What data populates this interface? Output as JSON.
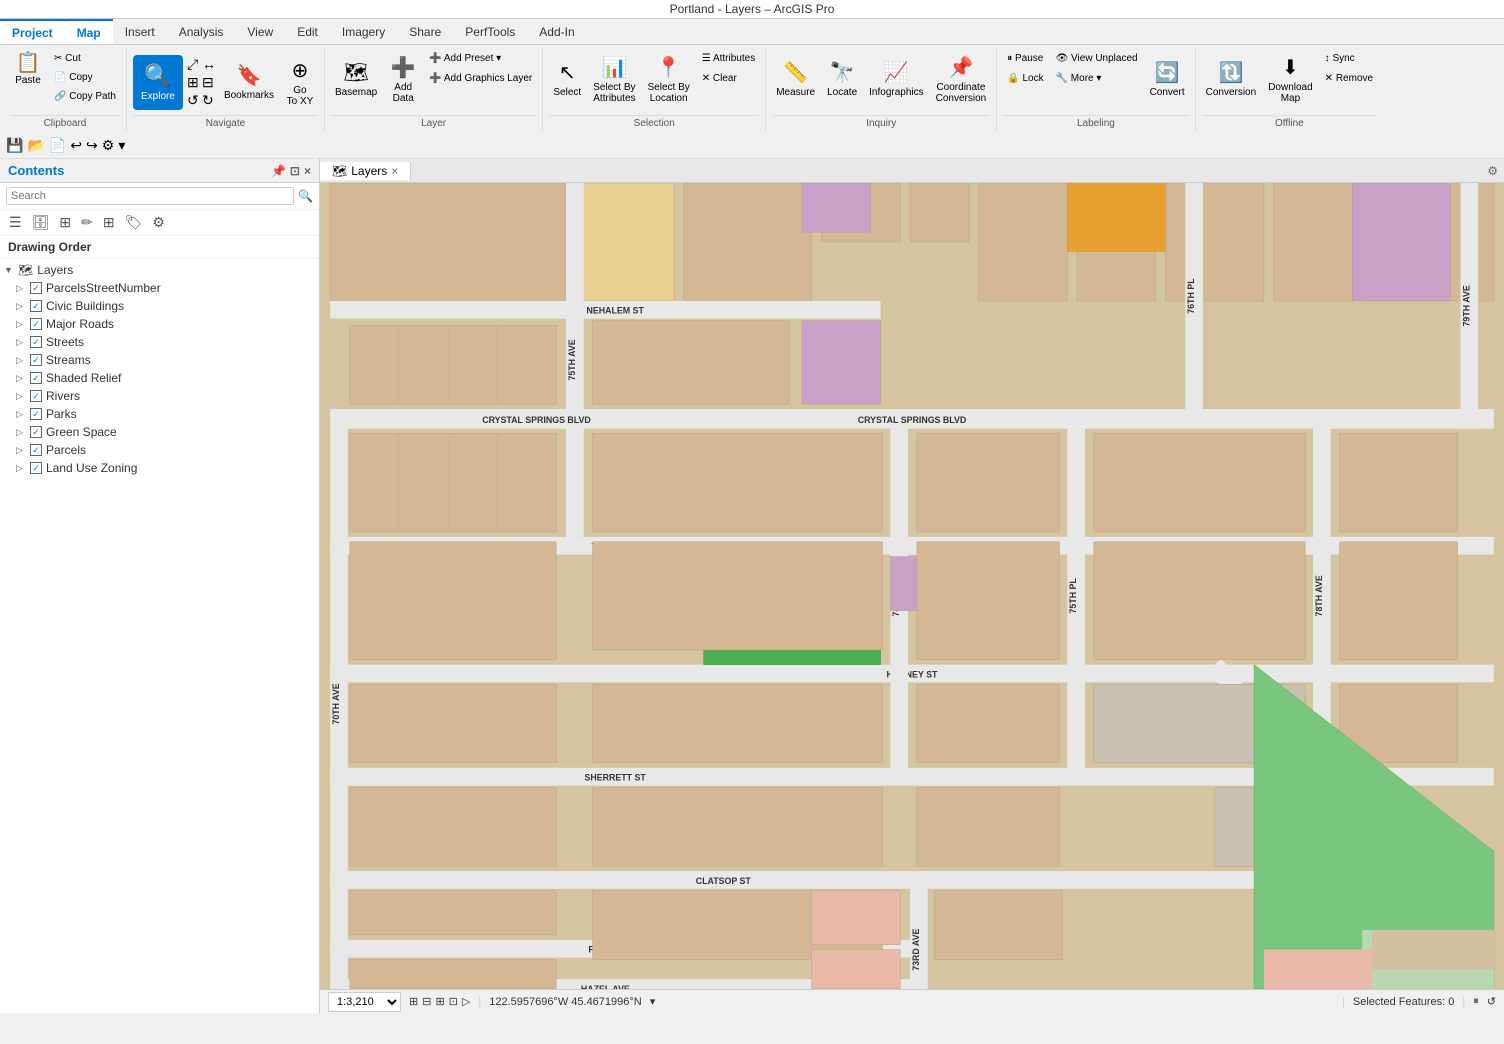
{
  "titlebar": {
    "text": "Portland - Layers – ArcGIS Pro"
  },
  "tabs": {
    "items": [
      "Project",
      "Map",
      "Insert",
      "Analysis",
      "View",
      "Edit",
      "Imagery",
      "Share",
      "PerfTools",
      "Add-In"
    ]
  },
  "ribbon": {
    "groups": [
      {
        "name": "Clipboard",
        "buttons": [
          "Paste",
          "Cut",
          "Copy",
          "Copy Path"
        ]
      },
      {
        "name": "Navigate",
        "buttons": [
          "Explore",
          "Bookmarks",
          "Go To XY"
        ]
      },
      {
        "name": "Layer",
        "buttons": [
          "Basemap",
          "Add Data",
          "Add Preset",
          "Add Graphics Layer"
        ]
      },
      {
        "name": "Selection",
        "buttons": [
          "Select",
          "Select By Attributes",
          "Select By Location",
          "Attributes",
          "Clear"
        ]
      },
      {
        "name": "Inquiry",
        "buttons": [
          "Measure",
          "Locate",
          "Infographics",
          "Coordinate Conversion"
        ]
      },
      {
        "name": "Labeling",
        "buttons": [
          "Pause",
          "Lock",
          "View Unplaced",
          "More",
          "Convert"
        ]
      },
      {
        "name": "Offline",
        "buttons": [
          "Sync",
          "Remove",
          "Conversion",
          "Download Map"
        ]
      }
    ]
  },
  "contents": {
    "title": "Contents",
    "search_placeholder": "Search",
    "drawing_order_label": "Drawing Order",
    "layers": [
      {
        "name": "Layers",
        "level": 0,
        "type": "group",
        "expanded": true
      },
      {
        "name": "ParcelsStreetNumber",
        "level": 1,
        "type": "layer",
        "checked": true
      },
      {
        "name": "Civic Buildings",
        "level": 1,
        "type": "layer",
        "checked": true
      },
      {
        "name": "Major Roads",
        "level": 1,
        "type": "layer",
        "checked": true
      },
      {
        "name": "Streets",
        "level": 1,
        "type": "layer",
        "checked": true
      },
      {
        "name": "Streams",
        "level": 1,
        "type": "layer",
        "checked": true
      },
      {
        "name": "Shaded Relief",
        "level": 1,
        "type": "layer",
        "checked": true
      },
      {
        "name": "Rivers",
        "level": 1,
        "type": "layer",
        "checked": true
      },
      {
        "name": "Parks",
        "level": 1,
        "type": "layer",
        "checked": true
      },
      {
        "name": "Green Space",
        "level": 1,
        "type": "layer",
        "checked": true
      },
      {
        "name": "Parcels",
        "level": 1,
        "type": "layer",
        "checked": true
      },
      {
        "name": "Land Use Zoning",
        "level": 1,
        "type": "layer",
        "checked": true
      }
    ]
  },
  "map_tab": {
    "label": "Layers",
    "close_icon": "×"
  },
  "status_bar": {
    "scale": "1:3,210",
    "coordinates": "122.5957696°W 45.4671996°N",
    "selected_features": "Selected Features: 0"
  }
}
